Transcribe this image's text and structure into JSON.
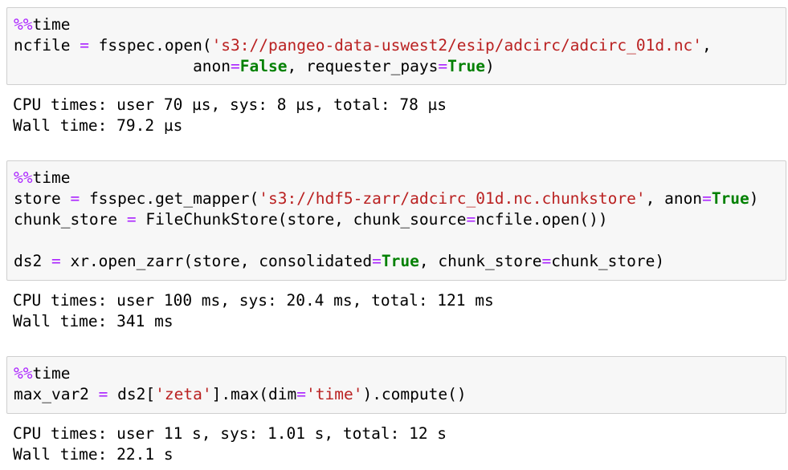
{
  "cells": [
    {
      "input": {
        "magic": "%%",
        "magic_cmd": "time",
        "line1_a": "ncfile ",
        "line1_eq": "=",
        "line1_b": " fsspec.open(",
        "line1_str": "'s3://pangeo-data-uswest2/esip/adcirc/adcirc_01d.nc'",
        "line1_c": ",",
        "line2_indent": "                   ",
        "line2_a": "anon",
        "line2_eq": "=",
        "line2_kw": "False",
        "line2_b": ", requester_pays",
        "line2_eq2": "=",
        "line2_kw2": "True",
        "line2_c": ")"
      },
      "output": {
        "line1": "CPU times: user 70 µs, sys: 8 µs, total: 78 µs",
        "line2": "Wall time: 79.2 µs"
      }
    },
    {
      "input": {
        "magic": "%%",
        "magic_cmd": "time",
        "line1_a": "store ",
        "line1_eq": "=",
        "line1_b": " fsspec.get_mapper(",
        "line1_str": "'s3://hdf5-zarr/adcirc_01d.nc.chunkstore'",
        "line1_c": ", anon",
        "line1_eq2": "=",
        "line1_kw": "True",
        "line1_d": ")",
        "line2_a": "chunk_store ",
        "line2_eq": "=",
        "line2_b": " FileChunkStore(store, chunk_source",
        "line2_eq2": "=",
        "line2_c": "ncfile.open())",
        "line4_a": "ds2 ",
        "line4_eq": "=",
        "line4_b": " xr.open_zarr(store, consolidated",
        "line4_eq2": "=",
        "line4_kw": "True",
        "line4_c": ", chunk_store",
        "line4_eq3": "=",
        "line4_d": "chunk_store)"
      },
      "output": {
        "line1": "CPU times: user 100 ms, sys: 20.4 ms, total: 121 ms",
        "line2": "Wall time: 341 ms"
      }
    },
    {
      "input": {
        "magic": "%%",
        "magic_cmd": "time",
        "line1_a": "max_var2 ",
        "line1_eq": "=",
        "line1_b": " ds2[",
        "line1_str": "'zeta'",
        "line1_c": "].max(dim",
        "line1_eq2": "=",
        "line1_str2": "'time'",
        "line1_d": ").compute()"
      },
      "output": {
        "line1": "CPU times: user 11 s, sys: 1.01 s, total: 12 s",
        "line2": "Wall time: 22.1 s"
      }
    }
  ]
}
